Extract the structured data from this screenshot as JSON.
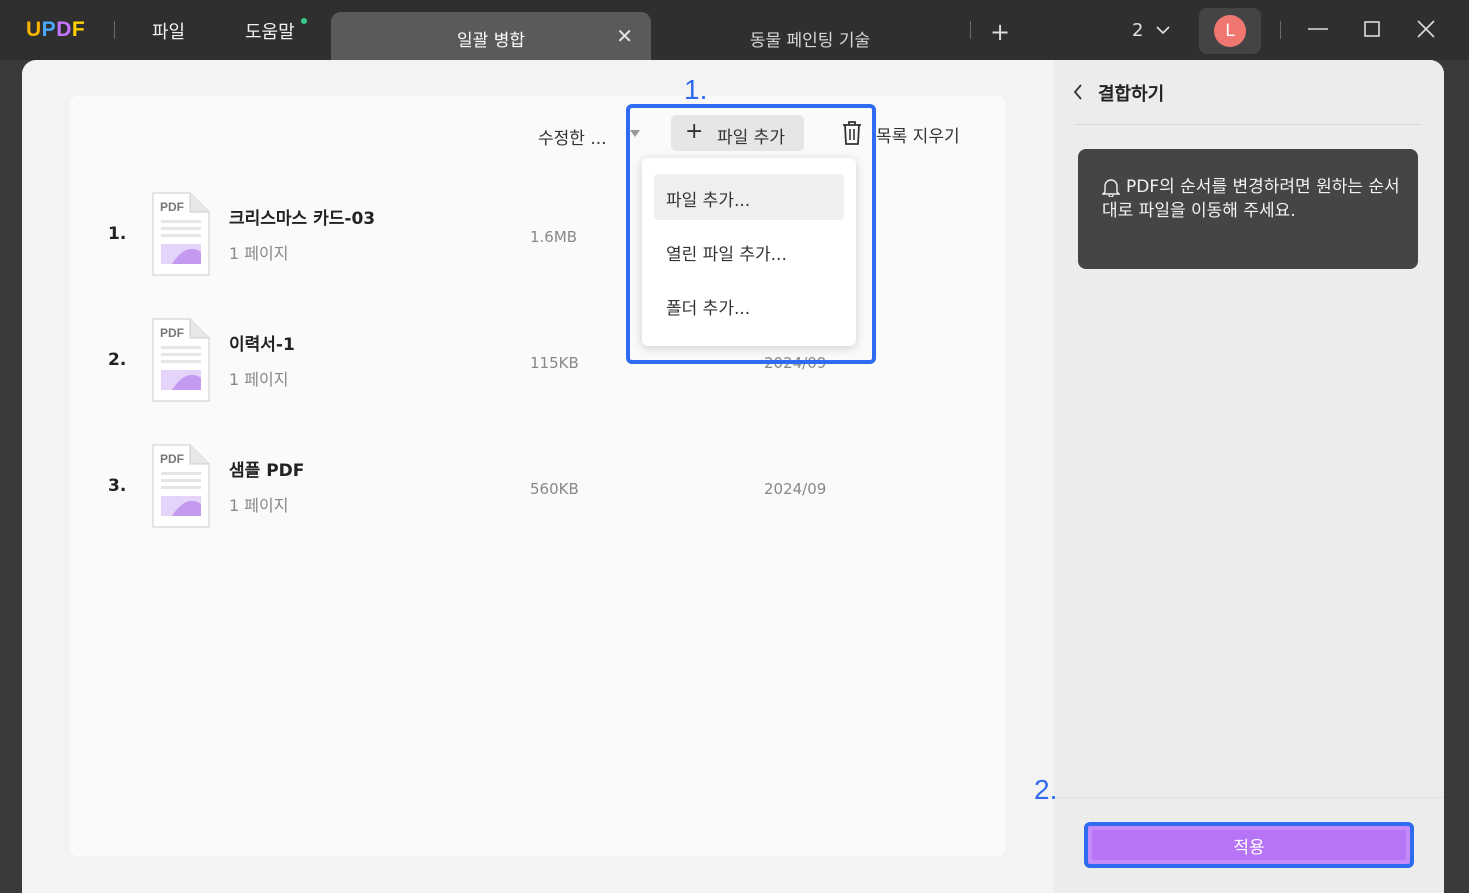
{
  "titlebar": {
    "logo": {
      "u": "U",
      "p": "P",
      "d": "D",
      "f": "F"
    },
    "menu": [
      {
        "label": "파일"
      },
      {
        "label": "도움말"
      }
    ],
    "tabs": [
      {
        "label": "일괄 병합",
        "active": true
      },
      {
        "label": "동물 페인팅 기술",
        "active": false
      }
    ],
    "tab_count": "2",
    "avatar_initial": "L"
  },
  "toolbar": {
    "sort_label": "수정한 ...",
    "add_file_label": "파일 추가",
    "clear_list_label": "목록 지우기"
  },
  "files": [
    {
      "num": "1.",
      "name": "크리스마스 카드-03",
      "pages": "1 페이지",
      "size": "1.6MB",
      "date": ""
    },
    {
      "num": "2.",
      "name": "이력서-1",
      "pages": "1 페이지",
      "size": "115KB",
      "date": "2024/09"
    },
    {
      "num": "3.",
      "name": "샘플 PDF",
      "pages": "1 페이지",
      "size": "560KB",
      "date": "2024/09"
    }
  ],
  "dropdown": {
    "items": [
      {
        "label": "파일 추가..."
      },
      {
        "label": "열린 파일 추가..."
      },
      {
        "label": "폴더 추가..."
      }
    ]
  },
  "steps": {
    "one": "1.",
    "two": "2."
  },
  "right_panel": {
    "title": "결합하기",
    "tip": "PDF의 순서를 변경하려면 원하는 순서대로 파일을 이동해 주세요.",
    "apply_label": "적용"
  },
  "colors": {
    "accent_purple": "#b774f7",
    "highlight_blue": "#2e6bf0",
    "avatar": "#f0776f",
    "titlebar": "#2f2f2f"
  }
}
